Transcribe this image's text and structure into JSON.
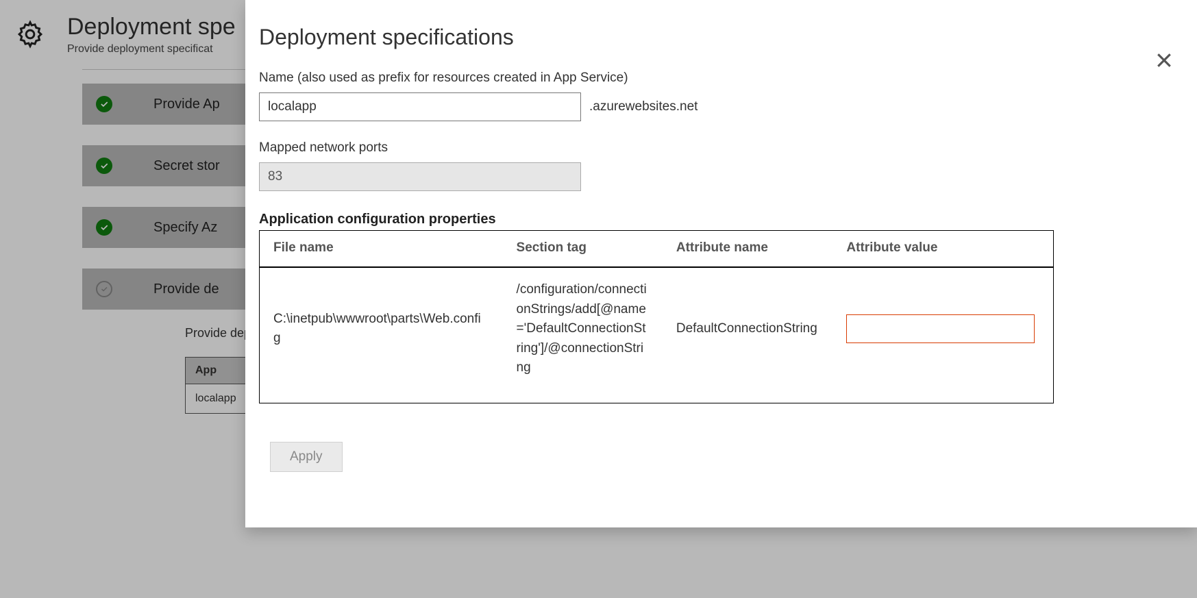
{
  "background": {
    "title": "Deployment spe",
    "subtitle": "Provide deployment specificat",
    "steps": [
      {
        "label": "Provide Ap",
        "done": true
      },
      {
        "label": "Secret stor",
        "done": true
      },
      {
        "label": "Specify Az",
        "done": true
      },
      {
        "label": "Provide de",
        "done": false
      }
    ],
    "detailText": "Provide deployme\ngenerate specs.",
    "table": {
      "header": "App",
      "row": "localapp"
    }
  },
  "modal": {
    "title": "Deployment specifications",
    "nameLabel": "Name (also used as prefix for resources created in App Service)",
    "nameValue": "localapp",
    "nameSuffix": ".azurewebsites.net",
    "portsLabel": "Mapped network ports",
    "portsValue": "83",
    "configHeading": "Application configuration properties",
    "columns": {
      "file": "File name",
      "section": "Section tag",
      "attr": "Attribute name",
      "val": "Attribute value"
    },
    "row": {
      "file": "C:\\inetpub\\wwwroot\\parts\\Web.config",
      "section": "/configuration/connectionStrings/add[@name='DefaultConnectionString']/@connectionString",
      "attr": "DefaultConnectionString",
      "val": ""
    },
    "applyLabel": "Apply"
  }
}
